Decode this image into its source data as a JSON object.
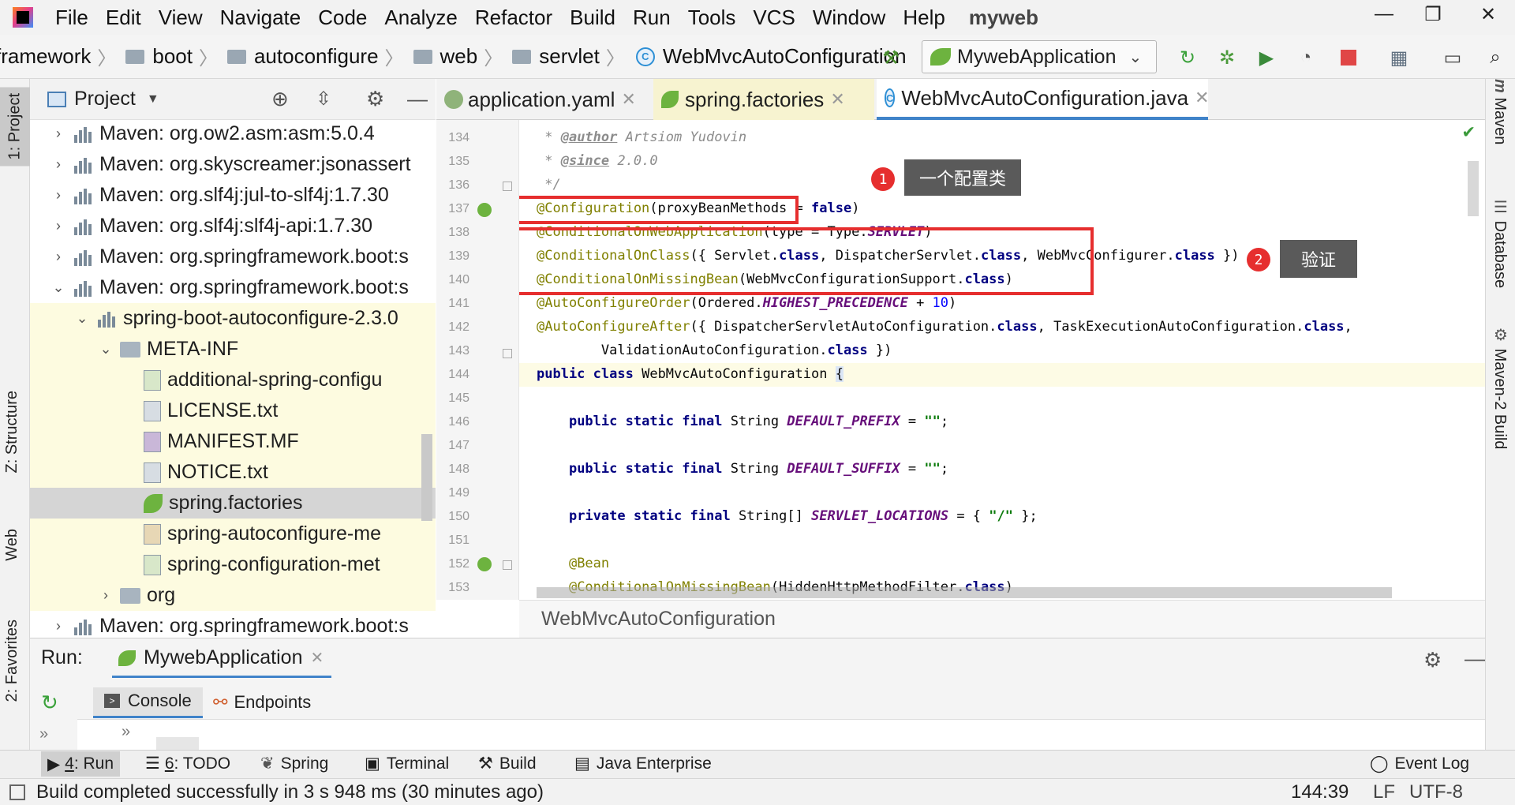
{
  "menubar": {
    "items": [
      "File",
      "Edit",
      "View",
      "Navigate",
      "Code",
      "Analyze",
      "Refactor",
      "Build",
      "Run",
      "Tools",
      "VCS",
      "Window",
      "Help"
    ],
    "project_name": "myweb"
  },
  "navbar": {
    "crumbs": [
      "framework",
      "boot",
      "autoconfigure",
      "web",
      "servlet"
    ],
    "current": "WebMvcAutoConfiguration",
    "run_config": "MywebApplication"
  },
  "project_panel": {
    "title": "Project",
    "rows": [
      {
        "label": "Maven: org.ow2.asm:asm:5.0.4",
        "arrow": "›",
        "indent": 0,
        "icon": "library-icon"
      },
      {
        "label": "Maven: org.skyscreamer:jsonassert",
        "arrow": "›",
        "indent": 0,
        "icon": "library-icon"
      },
      {
        "label": "Maven: org.slf4j:jul-to-slf4j:1.7.30",
        "arrow": "›",
        "indent": 0,
        "icon": "library-icon"
      },
      {
        "label": "Maven: org.slf4j:slf4j-api:1.7.30",
        "arrow": "›",
        "indent": 0,
        "icon": "library-icon"
      },
      {
        "label": "Maven: org.springframework.boot:s",
        "arrow": "›",
        "indent": 0,
        "icon": "library-icon"
      },
      {
        "label": "Maven: org.springframework.boot:s",
        "arrow": "⌄",
        "indent": 0,
        "icon": "library-icon"
      },
      {
        "label": "spring-boot-autoconfigure-2.3.0",
        "arrow": "⌄",
        "indent": 1,
        "icon": "jar-icon"
      },
      {
        "label": "META-INF",
        "arrow": "⌄",
        "indent": 2,
        "icon": "folder-icon"
      },
      {
        "label": "additional-spring-configu",
        "arrow": "",
        "indent": 3,
        "icon": "json-file-icon"
      },
      {
        "label": "LICENSE.txt",
        "arrow": "",
        "indent": 3,
        "icon": "text-file-icon"
      },
      {
        "label": "MANIFEST.MF",
        "arrow": "",
        "indent": 3,
        "icon": "manifest-file-icon"
      },
      {
        "label": "NOTICE.txt",
        "arrow": "",
        "indent": 3,
        "icon": "text-file-icon"
      },
      {
        "label": "spring.factories",
        "arrow": "",
        "indent": 3,
        "icon": "spring-leaf-icon"
      },
      {
        "label": "spring-autoconfigure-me",
        "arrow": "",
        "indent": 3,
        "icon": "properties-file-icon"
      },
      {
        "label": "spring-configuration-met",
        "arrow": "",
        "indent": 3,
        "icon": "json-file-icon"
      },
      {
        "label": "org",
        "arrow": "›",
        "indent": 2,
        "icon": "folder-icon"
      },
      {
        "label": "Maven: org.springframework.boot:s",
        "arrow": "›",
        "indent": 0,
        "icon": "library-icon"
      }
    ]
  },
  "editor_tabs": [
    {
      "label": "application.yaml",
      "icon": "yaml-file-icon"
    },
    {
      "label": "spring.factories",
      "icon": "spring-leaf-icon"
    },
    {
      "label": "WebMvcAutoConfiguration.java",
      "icon": "class-icon"
    }
  ],
  "code": {
    "line_numbers": [
      "134",
      "135",
      "136",
      "137",
      "138",
      "139",
      "140",
      "141",
      "142",
      "143",
      "144",
      "145",
      "146",
      "147",
      "148",
      "149",
      "150",
      "151",
      "152",
      "153"
    ],
    "author_tag": "@author",
    "author_name": "Artsiom Yudovin",
    "since_tag": "@since",
    "since_value": "2.0.0",
    "annotations": {
      "configuration": "@Configuration",
      "cond_web": "@ConditionalOnWebApplication",
      "cond_class": "@ConditionalOnClass",
      "cond_missing": "@ConditionalOnMissingBean",
      "order": "@AutoConfigureOrder",
      "after": "@AutoConfigureAfter",
      "bean": "@Bean"
    },
    "keywords": {
      "false": "false",
      "class": "class",
      "public": "public",
      "static": "static",
      "final": "final",
      "private": "private"
    },
    "text": {
      "proxy": "(proxyBeanMethods = ",
      "type": "(type = Type.",
      "servlet_const": "SERVLET",
      "cond_class_args1": "({ Servlet.",
      "cond_class_args2": ", DispatcherServlet.",
      "cond_class_args3": ", WebMvcConfigurer.",
      "cond_class_end": " })",
      "cond_missing_arg": "(WebMvcConfigurationSupport.",
      "order_arg": "(Ordered.",
      "highest": "HIGHEST_PRECEDENCE",
      "plus": " + ",
      "ten": "10",
      "after_arg1": "({ DispatcherServletAutoConfiguration.",
      "after_arg2": ", TaskExecutionAutoConfiguration.",
      "validation": "ValidationAutoConfiguration.",
      "class_name": " WebMvcAutoConfiguration ",
      "brace": "{",
      "string_type": " String ",
      "string_arr": " String[] ",
      "default_prefix": "DEFAULT_PREFIX",
      "default_suffix": "DEFAULT_SUFFIX",
      "servlet_locations": "SERVLET_LOCATIONS",
      "empty_str": "\"\"",
      "slash_str": "\"/\"",
      "hidden_filter": "(HiddenHttpMethodFilter."
    }
  },
  "callouts": [
    {
      "number": "1",
      "text": "一个配置类"
    },
    {
      "number": "2",
      "text": "验证"
    }
  ],
  "code_breadcrumb": "WebMvcAutoConfiguration",
  "run_panel": {
    "run_label": "Run:",
    "app_tab": "MywebApplication",
    "console": "Console",
    "endpoints": "Endpoints"
  },
  "bottom_tabs": [
    {
      "num": "4",
      "label": ": Run"
    },
    {
      "num": "6",
      "label": ": TODO"
    },
    {
      "num": "",
      "label": "Spring"
    },
    {
      "num": "",
      "label": "Terminal"
    },
    {
      "num": "",
      "label": "Build"
    },
    {
      "num": "",
      "label": "Java Enterprise"
    }
  ],
  "event_log": "Event Log",
  "status": {
    "message": "Build completed successfully in 3 s 948 ms (30 minutes ago)",
    "position": "144:39",
    "line_sep": "LF",
    "encoding": "UTF-8"
  },
  "stripes": {
    "left": [
      "1: Project",
      "Z: Structure",
      "Web",
      "2: Favorites"
    ],
    "right": [
      "Maven",
      "Database",
      "Maven-2 Build"
    ]
  }
}
